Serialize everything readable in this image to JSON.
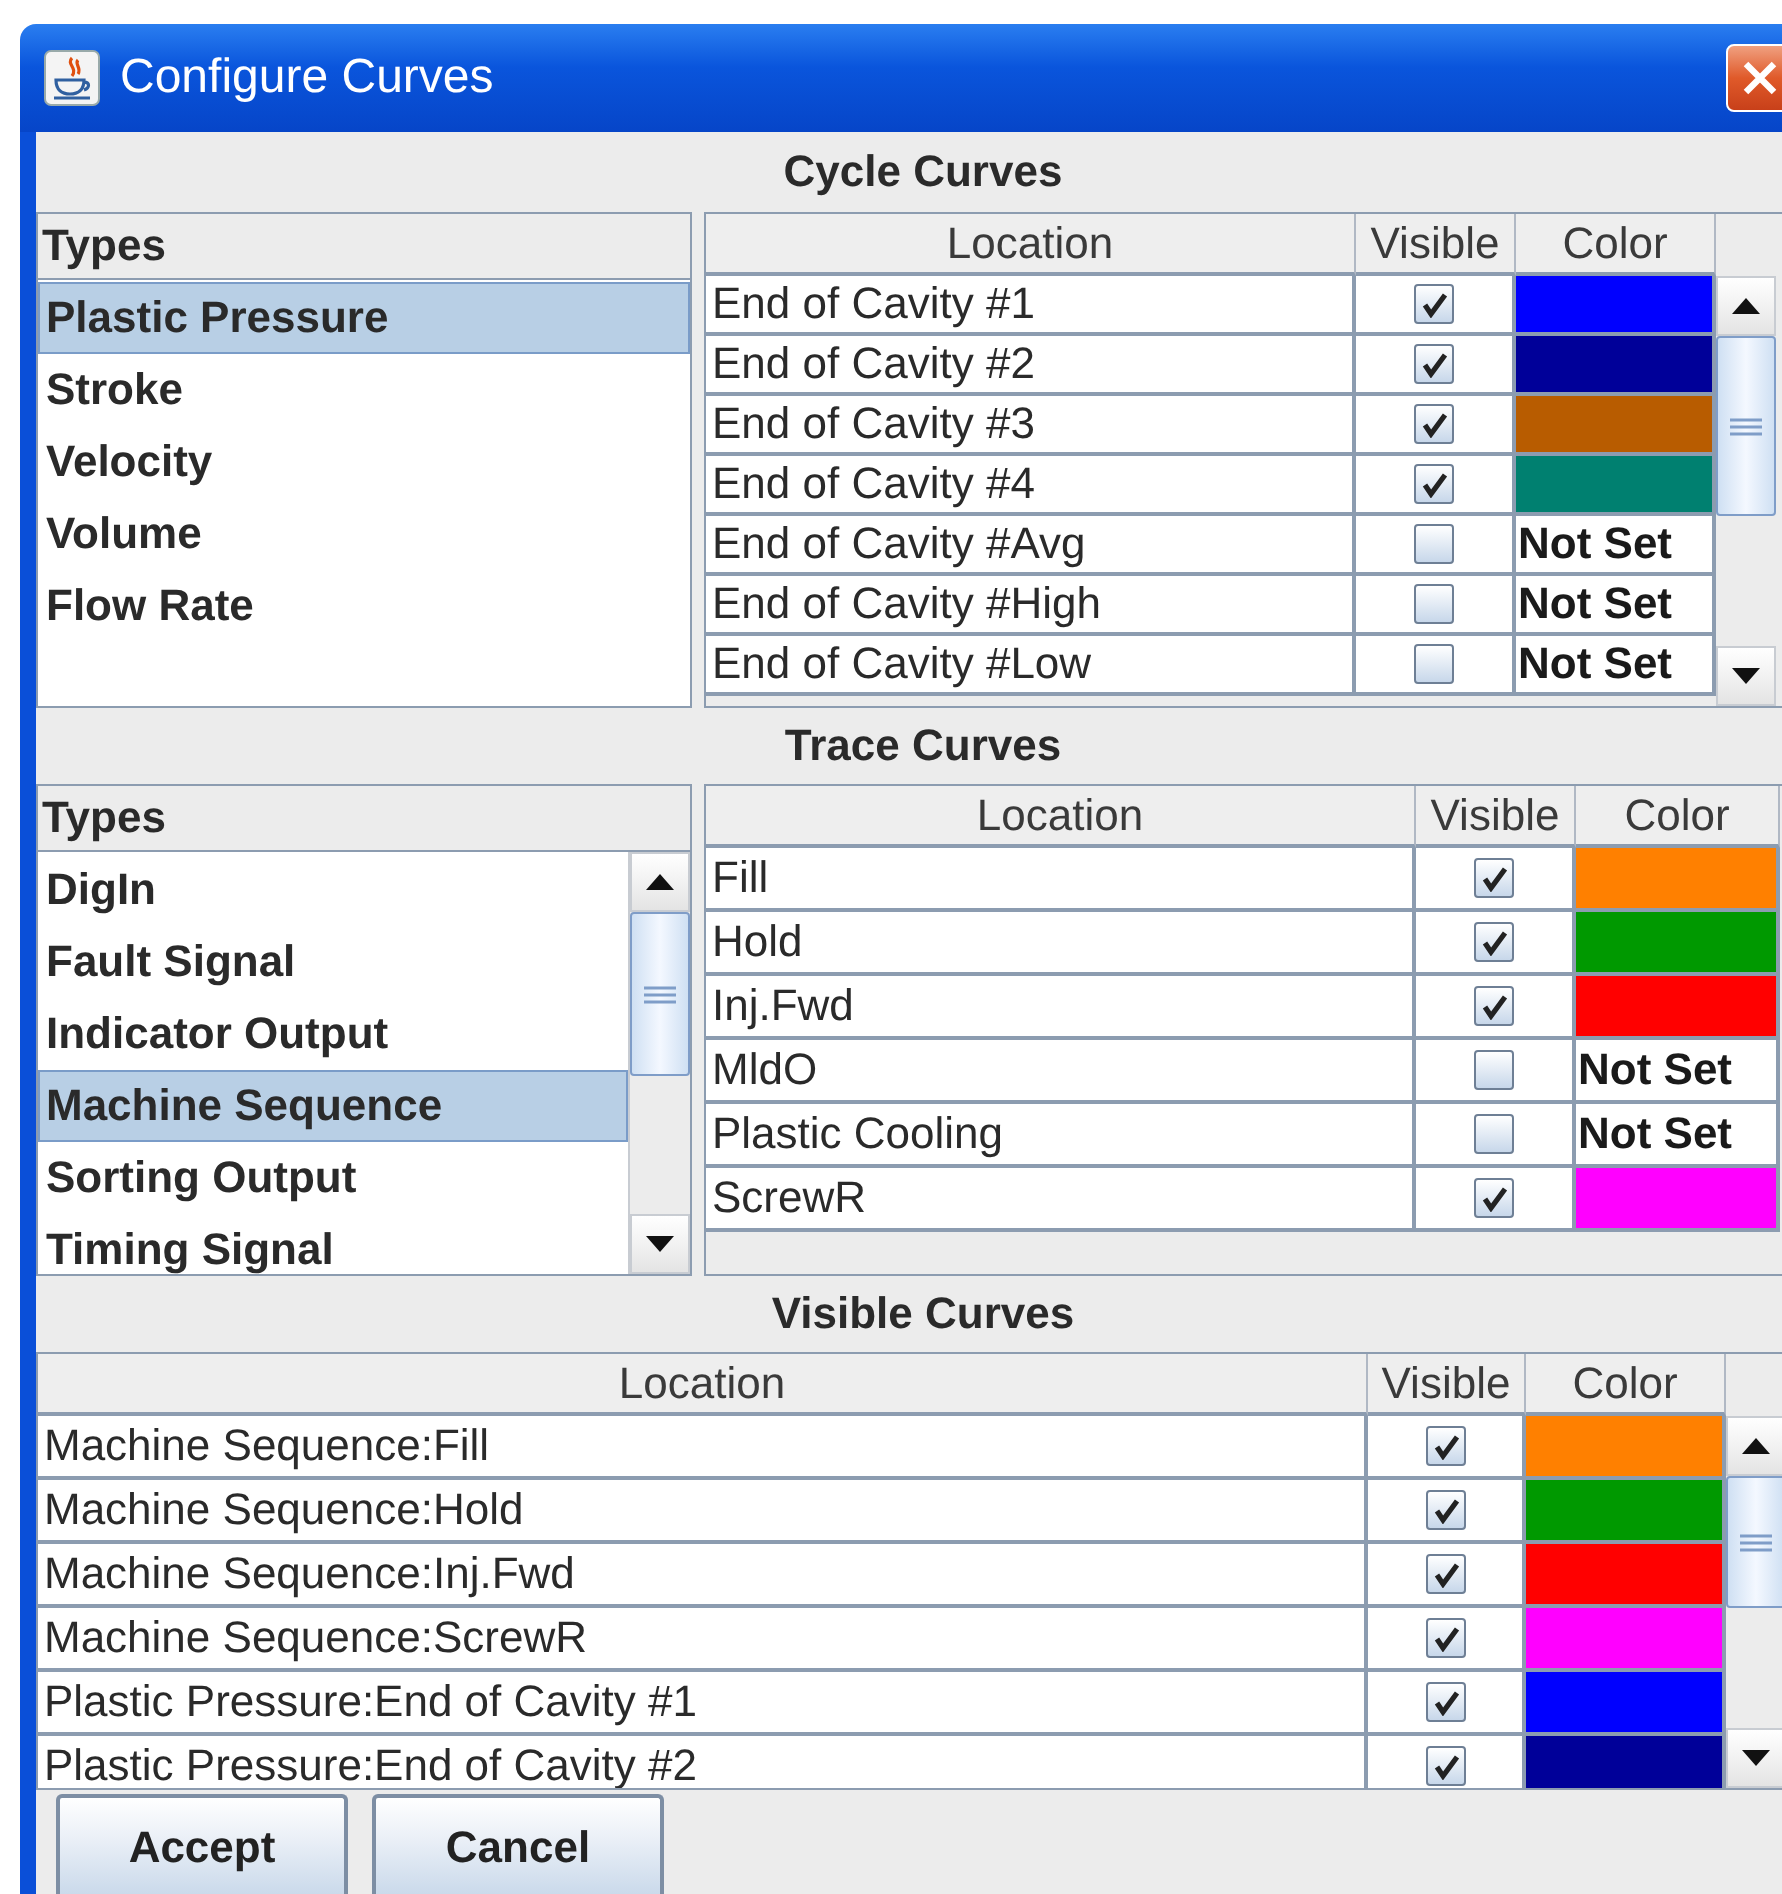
{
  "window": {
    "title": "Configure Curves"
  },
  "cycle_curves": {
    "title": "Cycle Curves",
    "types_header": "Types",
    "types": [
      {
        "label": "Plastic Pressure",
        "selected": true
      },
      {
        "label": "Stroke",
        "selected": false
      },
      {
        "label": "Velocity",
        "selected": false
      },
      {
        "label": "Volume",
        "selected": false
      },
      {
        "label": "Flow Rate",
        "selected": false
      }
    ],
    "columns": [
      "Location",
      "Visible",
      "Color"
    ],
    "rows": [
      {
        "location": "End of Cavity #1",
        "visible": true,
        "color": "#0000ff"
      },
      {
        "location": "End of Cavity #2",
        "visible": true,
        "color": "#000099"
      },
      {
        "location": "End of Cavity #3",
        "visible": true,
        "color": "#b85c00"
      },
      {
        "location": "End of Cavity #4",
        "visible": true,
        "color": "#008070"
      },
      {
        "location": "End of Cavity #Avg",
        "visible": false,
        "color_label": "Not Set"
      },
      {
        "location": "End of Cavity #High",
        "visible": false,
        "color_label": "Not Set"
      },
      {
        "location": "End of Cavity #Low",
        "visible": false,
        "color_label": "Not Set"
      }
    ]
  },
  "trace_curves": {
    "title": "Trace Curves",
    "types_header": "Types",
    "types": [
      {
        "label": "DigIn",
        "selected": false
      },
      {
        "label": "Fault Signal",
        "selected": false
      },
      {
        "label": "Indicator Output",
        "selected": false
      },
      {
        "label": "Machine Sequence",
        "selected": true
      },
      {
        "label": "Sorting Output",
        "selected": false
      },
      {
        "label": "Timing Signal",
        "selected": false
      }
    ],
    "columns": [
      "Location",
      "Visible",
      "Color"
    ],
    "rows": [
      {
        "location": "Fill",
        "visible": true,
        "color": "#ff8000"
      },
      {
        "location": "Hold",
        "visible": true,
        "color": "#009900"
      },
      {
        "location": "Inj.Fwd",
        "visible": true,
        "color": "#ff0000"
      },
      {
        "location": "MldO",
        "visible": false,
        "color_label": "Not Set"
      },
      {
        "location": "Plastic Cooling",
        "visible": false,
        "color_label": "Not Set"
      },
      {
        "location": "ScrewR",
        "visible": true,
        "color": "#ff00ff"
      }
    ]
  },
  "visible_curves": {
    "title": "Visible Curves",
    "columns": [
      "Location",
      "Visible",
      "Color"
    ],
    "rows": [
      {
        "location": "Machine Sequence:Fill",
        "visible": true,
        "color": "#ff8000"
      },
      {
        "location": "Machine Sequence:Hold",
        "visible": true,
        "color": "#009900"
      },
      {
        "location": "Machine Sequence:Inj.Fwd",
        "visible": true,
        "color": "#ff0000"
      },
      {
        "location": "Machine Sequence:ScrewR",
        "visible": true,
        "color": "#ff00ff"
      },
      {
        "location": "Plastic Pressure:End of Cavity #1",
        "visible": true,
        "color": "#0000ff"
      },
      {
        "location": "Plastic Pressure:End of Cavity #2",
        "visible": true,
        "color": "#000099"
      }
    ]
  },
  "buttons": [
    "Accept",
    "Cancel"
  ]
}
